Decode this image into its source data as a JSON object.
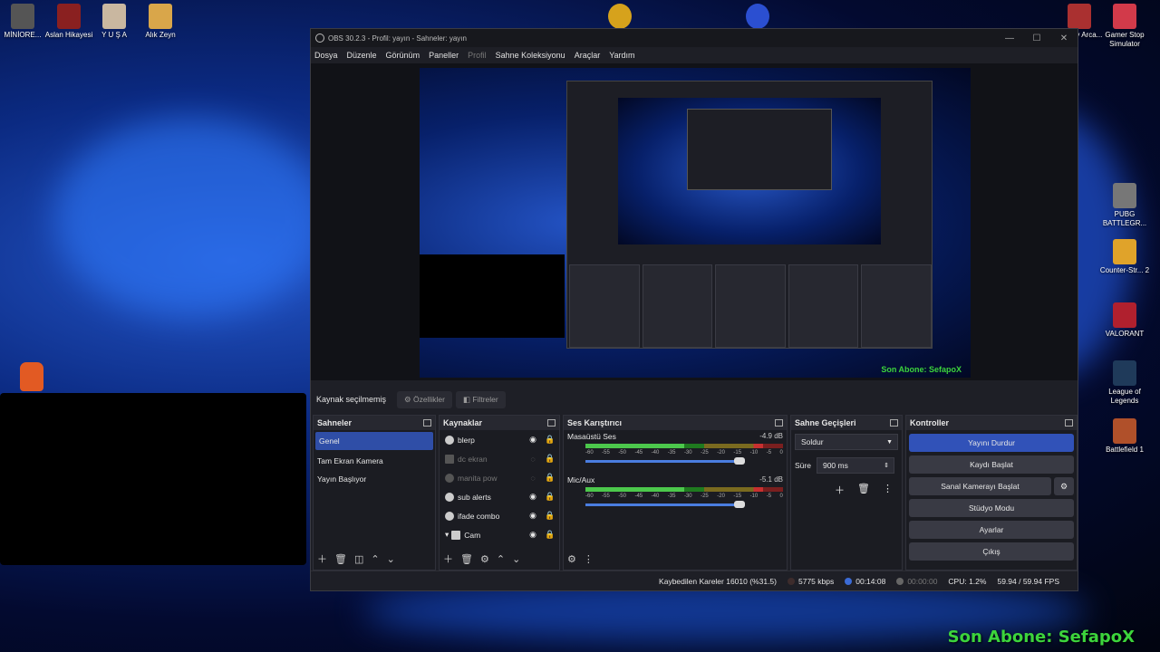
{
  "desktop": {
    "left_icons": [
      {
        "label": "MİNİORE..."
      },
      {
        "label": "Aslan Hikayesi"
      },
      {
        "label": "Y U Ş A"
      },
      {
        "label": "Alık Zeyn"
      }
    ],
    "right_icons": [
      {
        "label": "an Tidy Arca..."
      },
      {
        "label": "Gamer Stop Simulator"
      },
      {
        "label": "PUBG BATTLEGR..."
      },
      {
        "label": "Counter-Str... 2"
      },
      {
        "label": "VALORANT"
      },
      {
        "label": "League of Legends"
      },
      {
        "label": "Battlefield 1"
      }
    ],
    "overlay": "Son Abone: SefapoX"
  },
  "obs": {
    "title": "OBS 30.2.3 - Profil: yayın - Sahneler: yayın",
    "menu": [
      "Dosya",
      "Düzenle",
      "Görünüm",
      "Paneller",
      "Profil",
      "Sahne Koleksiyonu",
      "Araçlar",
      "Yardım"
    ],
    "preview_overlay": "Son Abone: SefapoX",
    "source_status": "Kaynak seçilmemiş",
    "properties_label": "Özellikler",
    "filters_label": "Filtreler",
    "scenes": {
      "title": "Sahneler",
      "items": [
        "Genel",
        "Tam Ekran Kamera",
        "Yayın Başlıyor"
      ]
    },
    "sources": {
      "title": "Kaynaklar",
      "items": [
        {
          "name": "blerp"
        },
        {
          "name": "dc ekran"
        },
        {
          "name": "manita pow"
        },
        {
          "name": "sub alerts"
        },
        {
          "name": "ifade combo"
        },
        {
          "name": "Cam"
        }
      ]
    },
    "mixer": {
      "title": "Ses Karıştırıcı",
      "channels": [
        {
          "name": "Masaüstü Ses",
          "db": "-4.9 dB"
        },
        {
          "name": "Mic/Aux",
          "db": "-5.1 dB"
        }
      ],
      "scale": [
        "-60",
        "-55",
        "-50",
        "-45",
        "-40",
        "-35",
        "-30",
        "-25",
        "-20",
        "-15",
        "-10",
        "-5",
        "0"
      ]
    },
    "transitions": {
      "title": "Sahne Geçişleri",
      "selected": "Soldur",
      "duration_label": "Süre",
      "duration": "900 ms"
    },
    "controls": {
      "title": "Kontroller",
      "stop_stream": "Yayını Durdur",
      "start_record": "Kaydı Başlat",
      "virtual_cam": "Sanal Kamerayı Başlat",
      "studio_mode": "Stüdyo Modu",
      "settings": "Ayarlar",
      "exit": "Çıkış"
    },
    "status": {
      "dropped": "Kaybedilen Kareler 16010 (%31.5)",
      "bitrate": "5775 kbps",
      "stream_time": "00:14:08",
      "rec_time": "00:00:00",
      "cpu": "CPU: 1.2%",
      "fps": "59.94 / 59.94 FPS"
    }
  },
  "colors": {
    "accent": "#3152b8",
    "overlay_green": "#3cd43c"
  }
}
